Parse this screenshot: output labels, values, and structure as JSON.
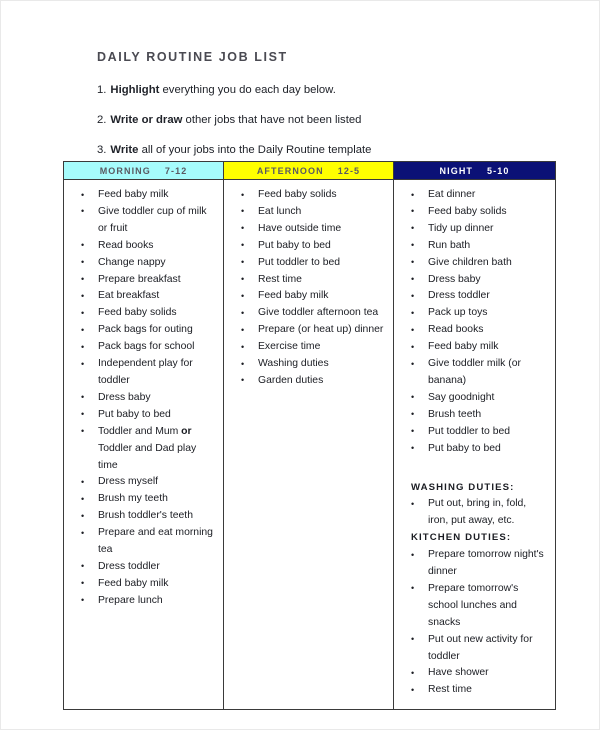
{
  "document": {
    "title": "DAILY  ROUTINE  JOB  LIST",
    "instructions": [
      {
        "num": "1.",
        "lead": "Highlight",
        "rest": " everything you do each day below."
      },
      {
        "num": "2.",
        "lead": "Write or draw",
        "rest": " other jobs that have not been listed"
      },
      {
        "num": "3.",
        "lead": "Write",
        "rest": " all of your jobs into the Daily Routine template"
      }
    ]
  },
  "colors": {
    "morning_header_bg": "#a6fcfc",
    "afternoon_header_bg": "#ffff00",
    "night_header_bg": "#0b1176",
    "night_header_text": "#ffffff",
    "header_text": "#5a5a62",
    "body_text": "#1b1d23",
    "border": "#3a3a3a"
  },
  "table": {
    "columns": [
      {
        "key": "morning",
        "header_label": "MORNING",
        "header_range": "7-12",
        "items": [
          "Feed baby milk",
          "Give toddler cup of milk or fruit",
          "Read books",
          "Change nappy",
          "Prepare breakfast",
          "Eat breakfast",
          "Feed baby solids",
          "Pack bags for outing",
          "Pack bags for school",
          "Independent play for toddler",
          "Dress baby",
          "Put baby to bed",
          "Toddler and Mum or Toddler and Dad play time",
          "Dress myself",
          "Brush my teeth",
          "Brush toddler's teeth",
          "Prepare and eat morning tea",
          "Dress toddler",
          "Feed baby milk",
          "Prepare lunch"
        ]
      },
      {
        "key": "afternoon",
        "header_label": "AFTERNOON",
        "header_range": "12-5",
        "items": [
          "Feed baby solids",
          "Eat lunch",
          "Have outside time",
          "Put baby to bed",
          "Put toddler to bed",
          "Rest time",
          "Feed baby milk",
          "Give toddler afternoon tea",
          "Prepare (or heat up) dinner",
          "Exercise time",
          "Washing duties",
          "Garden duties"
        ]
      },
      {
        "key": "night",
        "header_label": "NIGHT",
        "header_range": "5-10",
        "items": [
          "Eat dinner",
          "Feed baby solids",
          "Tidy up dinner",
          "Run bath",
          "Give children bath",
          "Dress baby",
          "Dress toddler",
          "Pack up toys",
          "Read books",
          "Feed baby milk",
          "Give toddler milk (or banana)",
          "Say goodnight",
          "Brush teeth",
          "Put toddler to bed",
          "Put baby to bed"
        ],
        "sections": [
          {
            "heading": "WASHING  DUTIES:",
            "items": [
              "Put out, bring in, fold, iron, put away, etc."
            ]
          },
          {
            "heading": "KITCHEN  DUTIES:",
            "items": [
              "Prepare tomorrow night's dinner",
              "Prepare tomorrow's school lunches and snacks",
              "Put out new activity for toddler",
              "Have shower",
              "Rest time"
            ]
          }
        ]
      }
    ]
  }
}
